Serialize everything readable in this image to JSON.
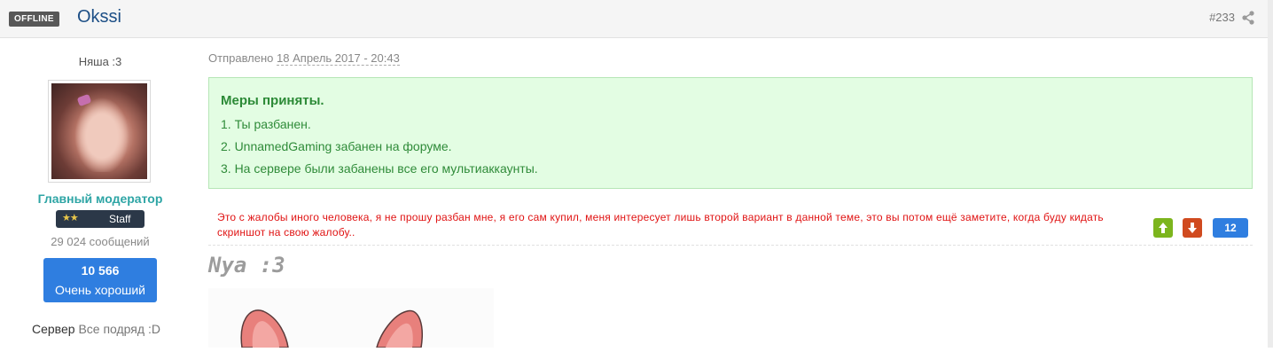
{
  "header": {
    "status_badge": "OFFLINE",
    "author": "Okssi",
    "post_number": "#233"
  },
  "sidebar": {
    "user_title": "Няша :3",
    "group_name": "Главный модератор",
    "staff_badge": "Staff",
    "post_count": "29 024 сообщений",
    "reputation": {
      "value": "10 566",
      "label": "Очень хороший"
    },
    "server_label": "Сервер",
    "server_value": "Все подряд :D"
  },
  "post": {
    "date_prefix": "Отправлено",
    "date": "18 Апрель 2017 - 20:43",
    "notice": {
      "title": "Меры приняты.",
      "items": [
        "1. Ты разбанен.",
        "2. UnnamedGaming забанен на форуме.",
        "3. На сервере были забанены все его мультиаккаунты."
      ]
    },
    "quote_text": "Это с жалобы иного человека, я не прошу разбан мне, я его сам купил, меня интересует лишь второй вариант в данной теме, это вы потом ещё заметите, когда буду кидать скриншот на свою жалобу..",
    "votes": "12",
    "signature_heading": "Nya :3"
  },
  "colors": {
    "link": "#1d4f86",
    "group": "#2ea5a5",
    "notice_bg": "#e3fde3",
    "notice_text": "#2c8a37",
    "quote": "#e01313",
    "rep": "#2f7ee0",
    "vote_up": "#7cb51d",
    "vote_down": "#d04a1f"
  },
  "icons": {
    "share": "share-icon",
    "vote_up": "arrow-up-icon",
    "vote_down": "arrow-down-icon"
  }
}
